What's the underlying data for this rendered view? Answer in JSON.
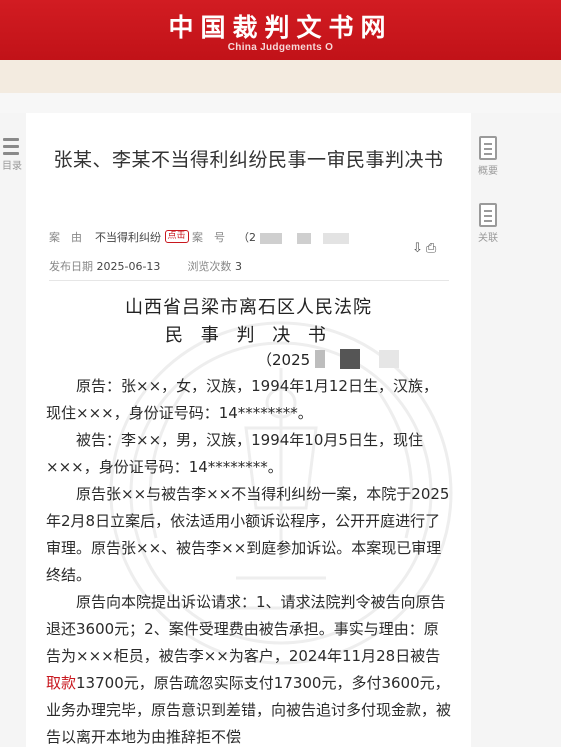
{
  "banner": {
    "title": "中国裁判文书网",
    "subtitle": "China Judgements O"
  },
  "side_left": {
    "label": "目录"
  },
  "side_right": [
    {
      "label": "概要",
      "icon": "document-summary-icon"
    },
    {
      "label": "关联",
      "icon": "document-related-icon"
    }
  ],
  "document": {
    "title": "张某、李某不当得利纠纷民事一审民事判决书",
    "meta": {
      "cause_label": "案　由",
      "cause_value": "不当得利纠纷",
      "cause_tag": "点击",
      "case_no_label": "案　号",
      "case_no_value": "（2",
      "publish_label": "发布日期",
      "publish_value": "2025-06-13",
      "views_label": "浏览次数",
      "views_value": "3"
    },
    "court": "山西省吕梁市离石区人民法院",
    "doc_type": "民 事 判 决 书",
    "case_number": "（2025",
    "paragraphs": [
      {
        "text": "原告：张××，女，汉族，1994年1月12日生，汉族，现住×××，身份证号码：14********。"
      },
      {
        "text": "被告：李××，男，汉族，1994年10月5日生，现住×××，身份证号码：14********。"
      },
      {
        "text": "原告张××与被告李××不当得利纠纷一案，本院于2025年2月8日立案后，依法适用小额诉讼程序，公开开庭进行了审理。原告张××、被告李××到庭参加诉讼。本案现已审理终结。"
      },
      {
        "before": "原告向本院提出诉讼请求：1、请求法院判令被告向原告退还3600元；2、案件受理费由被告承担。事实与理由：原告为×××柜员，被告李××为客户，2024年11月28日被告",
        "highlight": "取款",
        "after": "13700元，原告疏忽实际支付17300元，多付3600元，业务办理完毕，原告意识到差错，向被告追讨多付现金款，被告以离开本地为由推辞拒不偿"
      }
    ]
  },
  "colors": {
    "brand_red": "#c8171e",
    "highlight_red": "#c8171e"
  }
}
